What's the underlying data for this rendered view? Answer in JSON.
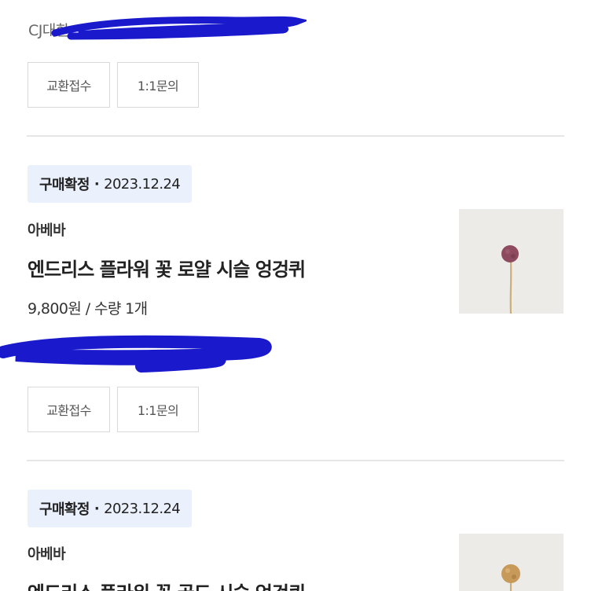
{
  "top": {
    "carrier_text": "CJ대한",
    "buttons": {
      "exchange": "교환접수",
      "inquiry": "1:1문의"
    }
  },
  "orders": [
    {
      "status_label": "구매확정",
      "separator": "·",
      "date": "2023.12.24",
      "seller": "아베바",
      "product_name": "엔드리스 플라워 꽃 로얄 시슬 엉겅퀴",
      "price_qty": "9,800원 / 수량 1개",
      "thumb_flower_color": "#8e4a5e",
      "buttons": {
        "exchange": "교환접수",
        "inquiry": "1:1문의"
      }
    },
    {
      "status_label": "구매확정",
      "separator": "·",
      "date": "2023.12.24",
      "seller": "아베바",
      "product_name": "엔드리스 플라워 꽃 골드 시슬 엉겅퀴",
      "thumb_flower_color": "#c79a5a"
    }
  ],
  "colors": {
    "status_bg": "#eaf0fc",
    "divider": "#e6e6e6",
    "redaction": "#1a1acc"
  }
}
